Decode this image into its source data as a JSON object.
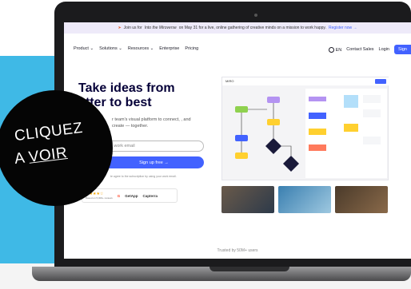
{
  "announcement": {
    "prefix": "Join us for",
    "event": "Into the Miroverse",
    "rest": "on May 31 for a live, online gathering of creative minds on a mission to work happy.",
    "link": "Register now →"
  },
  "nav": {
    "items": [
      "Product ⌄",
      "Solutions ⌄",
      "Resources ⌄",
      "Enterprise",
      "Pricing"
    ],
    "language": "EN",
    "contact": "Contact Sales",
    "login": "Login",
    "signup": "Sign"
  },
  "hero": {
    "title_line1": "Take ideas from",
    "title_line2": "etter to best",
    "subtitle": "r team's visual platform to connect, , and create — together.",
    "email_placeholder": "r work email",
    "cta": "Sign up free →",
    "consent": "te agree to the subscription by using your work email.",
    "rating_stars": "★★★★☆",
    "rating_text": "Based on 5,000+ reviews",
    "review_brands": [
      "G",
      "GetApp",
      "Capterra"
    ]
  },
  "board": {
    "name": "MIRO"
  },
  "trusted": "Trusted by 50M+ users",
  "overlay": {
    "line1": "CLIQUEZ",
    "line2_prefix": "A ",
    "line2_link": "VOIR"
  },
  "colors": {
    "brand": "#4262ff",
    "overlay_bg": "#050505",
    "background": "#3fb9e6"
  }
}
